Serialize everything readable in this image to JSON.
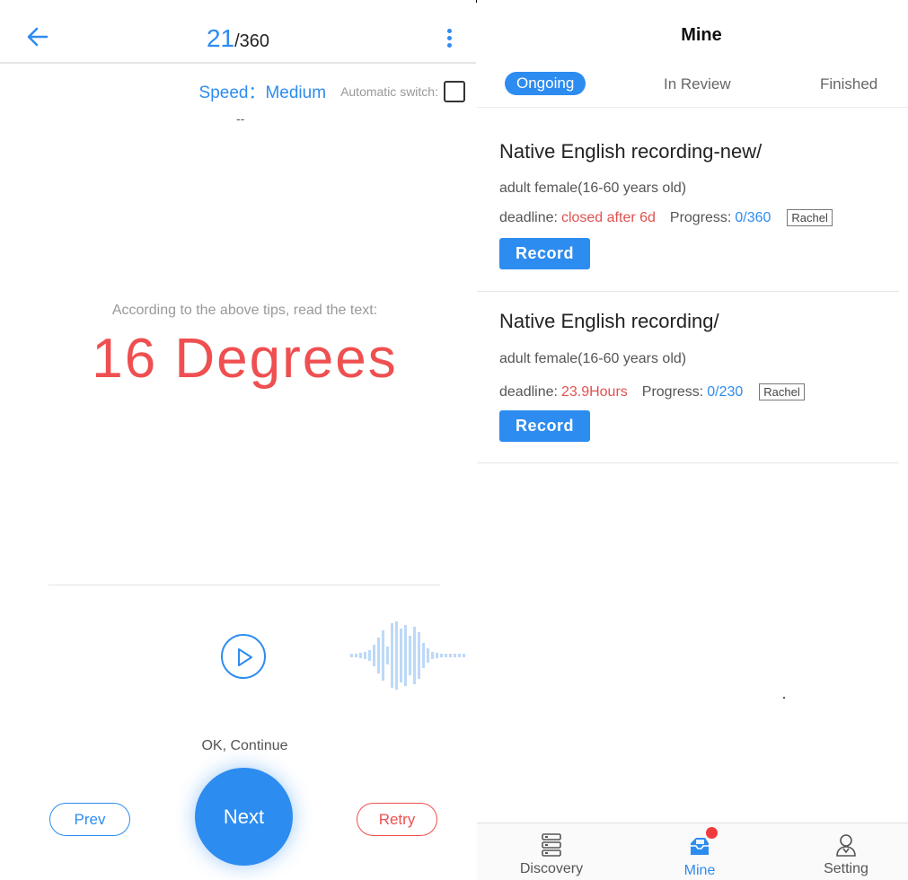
{
  "colors": {
    "accent": "#2d8cf0",
    "danger": "#ef4f50"
  },
  "recorder": {
    "counter_current": "21",
    "counter_total": "/360",
    "speed_label": "Speed：Medium",
    "auto_switch_label": "Automatic switch:",
    "dashes": "--",
    "tip": "According to the above tips, read the text:",
    "prompt_word": "16 Degrees",
    "ok_label": "OK, Continue",
    "prev_label": "Prev",
    "next_label": "Next",
    "retry_label": "Retry"
  },
  "mine": {
    "title": "Mine",
    "tabs": [
      {
        "label": "Ongoing",
        "active": true
      },
      {
        "label": "In Review",
        "active": false
      },
      {
        "label": "Finished",
        "active": false
      }
    ],
    "tasks": [
      {
        "title": "Native English recording-new/",
        "subtitle": "adult female(16-60 years old)",
        "deadline_label": "deadline:",
        "deadline_value": "closed after 6d",
        "progress_label": "Progress:",
        "progress_value": "0/360",
        "tag": "Rachel",
        "button_label": "Record"
      },
      {
        "title": "Native English recording/",
        "subtitle": "adult female(16-60 years old)",
        "deadline_label": "deadline:",
        "deadline_value": "23.9Hours",
        "progress_label": "Progress:",
        "progress_value": "0/230",
        "tag": "Rachel",
        "button_label": "Record"
      }
    ],
    "nav": [
      {
        "label": "Discovery",
        "icon": "list-icon"
      },
      {
        "label": "Mine",
        "icon": "inbox-icon",
        "active": true
      },
      {
        "label": "Setting",
        "icon": "user-icon"
      }
    ]
  }
}
